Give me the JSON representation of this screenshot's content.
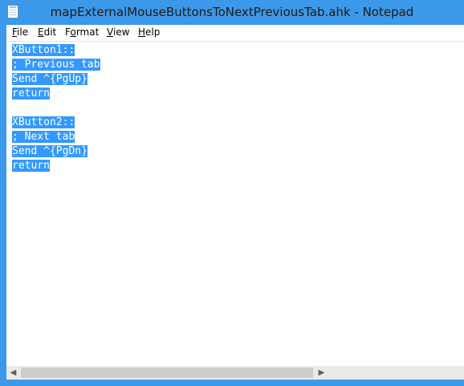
{
  "window": {
    "title": "mapExternalMouseButtonsToNextPreviousTab.ahk - Notepad"
  },
  "menu": {
    "file": {
      "u": "F",
      "rest": "ile"
    },
    "edit": {
      "u": "E",
      "rest": "dit"
    },
    "format": {
      "u": "o",
      "pre": "F",
      "rest": "rmat"
    },
    "view": {
      "u": "V",
      "rest": "iew"
    },
    "help": {
      "u": "H",
      "rest": "elp"
    }
  },
  "editor": {
    "lines": [
      "XButton1::",
      "; Previous tab",
      "Send ^{PgUp}",
      "return",
      "",
      "XButton2::",
      "; Next tab",
      "Send ^{PgDn}",
      "return"
    ]
  },
  "scrollbar": {
    "left_arrow": "◀",
    "right_arrow": "▶"
  },
  "colors": {
    "title_bar": "#3c99ea",
    "selection": "#3399ff"
  }
}
